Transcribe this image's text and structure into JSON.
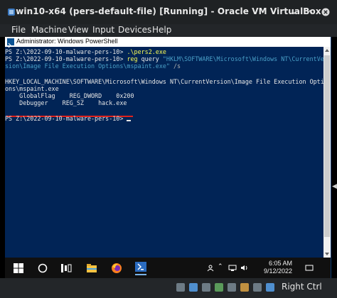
{
  "vbox": {
    "title": "win10-x64 (pers-default-file) [Running] - Oracle VM VirtualBox",
    "menu": [
      "File",
      "Machine",
      "View",
      "Input",
      "Devices",
      "Help"
    ],
    "host_key": "Right Ctrl"
  },
  "powershell": {
    "title": "Administrator: Windows PowerShell",
    "prompt1": "PS Z:\\2022-09-10-malware-pers-10> ",
    "cmd1": ".\\pers2.exe",
    "prompt2": "PS Z:\\2022-09-10-malware-pers-10> ",
    "cmd2_name": "reg",
    "cmd2_args": " query ",
    "cmd2_str_a": "\"HKLM\\SOFTWARE\\Microsoft\\Windows NT\\CurrentVer",
    "cmd2_str_b": "sion\\Image File Execution Options\\mspaint.exe\"",
    "cmd2_param": " /s",
    "key_line1": "HKEY_LOCAL_MACHINE\\SOFTWARE\\Microsoft\\Windows NT\\CurrentVersion\\Image File Execution Opti",
    "key_line2": "ons\\mspaint.exe",
    "row1": "    GlobalFlag    REG_DWORD    0x200",
    "row2": "    Debugger    REG_SZ    hack.exe",
    "prompt3": "PS Z:\\2022-09-10-malware-pers-10> "
  },
  "taskbar": {
    "time": "6:05 AM",
    "date": "9/12/2022",
    "icons": [
      "windows-start-icon",
      "search-circle-icon",
      "task-view-icon",
      "file-explorer-icon",
      "firefox-icon",
      "powershell-icon"
    ]
  },
  "colors": {
    "ps_background": "#012456",
    "command": "#fdfd55",
    "string": "#4aa0c8",
    "underline": "#e0221c"
  }
}
